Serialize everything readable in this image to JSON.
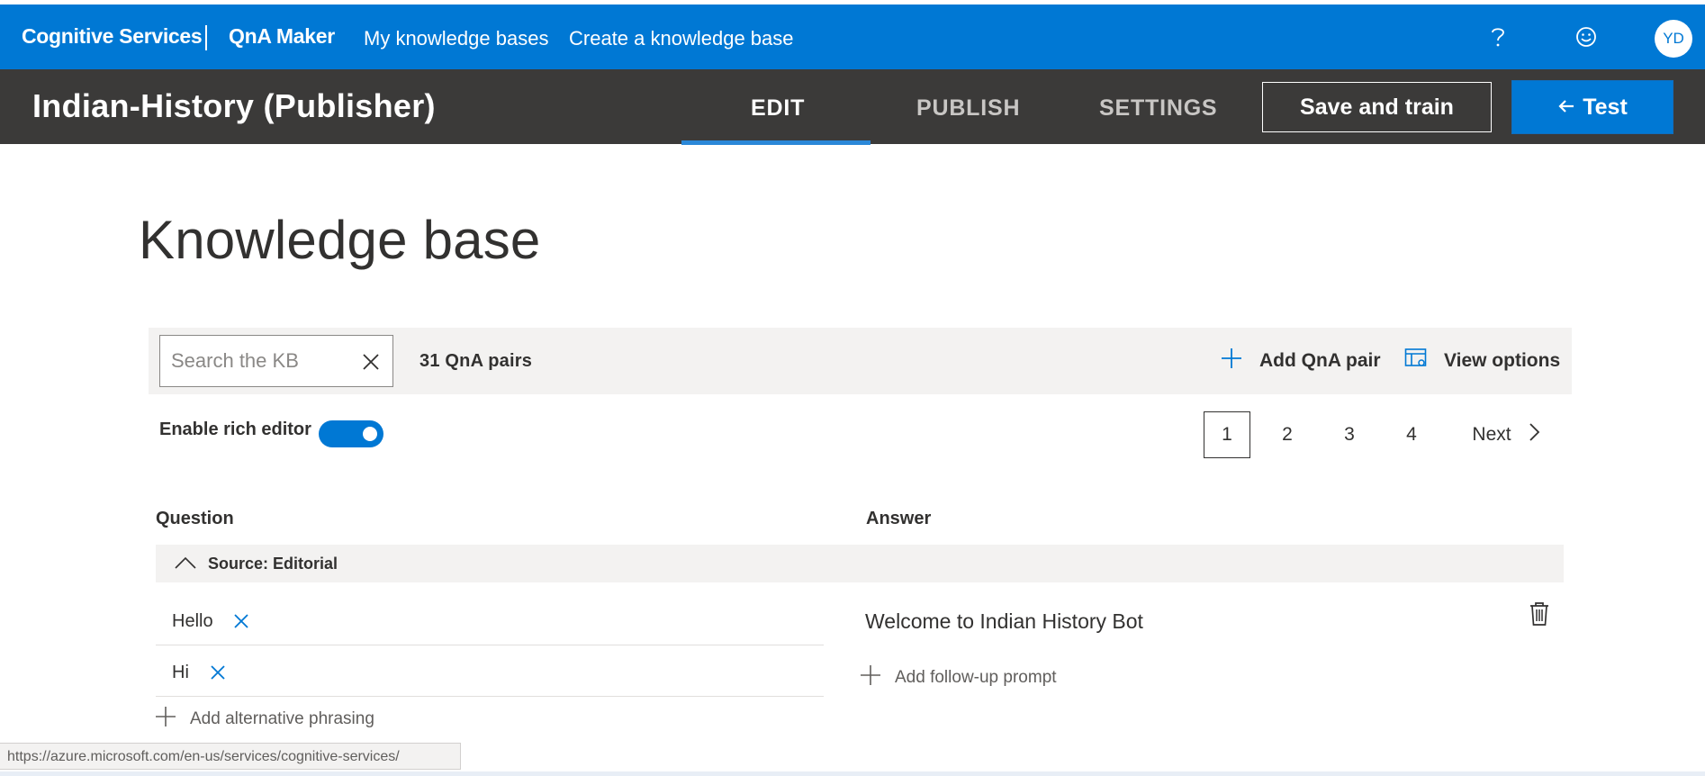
{
  "header": {
    "brand": "Cognitive Services",
    "product": "QnA Maker",
    "nav": [
      "My knowledge bases",
      "Create a knowledge base"
    ],
    "help_icon": "question-icon",
    "feedback_icon": "smiley-icon",
    "avatar_initials": "YD",
    "accent_color": "#0078d4"
  },
  "kb_bar": {
    "title": "Indian-History (Publisher)",
    "tabs": [
      "EDIT",
      "PUBLISH",
      "SETTINGS"
    ],
    "active_tab": "EDIT",
    "save_label": "Save and train",
    "test_label": "Test",
    "test_icon": "arrow-left-icon"
  },
  "main": {
    "title": "Knowledge base",
    "search_placeholder": "Search the KB",
    "pair_count": "31 QnA pairs",
    "add_pair_label": "Add QnA pair",
    "view_options_label": "View options",
    "rich_editor_label": "Enable rich editor",
    "rich_editor_enabled": true,
    "pagination": {
      "pages": [
        "1",
        "2",
        "3",
        "4"
      ],
      "current": "1",
      "next_label": "Next"
    },
    "columns": {
      "question": "Question",
      "answer": "Answer"
    },
    "source_label": "Source: Editorial",
    "questions": [
      "Hello",
      "Hi"
    ],
    "add_phrasing_label": "Add alternative phrasing",
    "answer": "Welcome to Indian History Bot",
    "add_prompt_label": "Add follow-up prompt"
  },
  "status_url": "https://azure.microsoft.com/en-us/services/cognitive-services/"
}
